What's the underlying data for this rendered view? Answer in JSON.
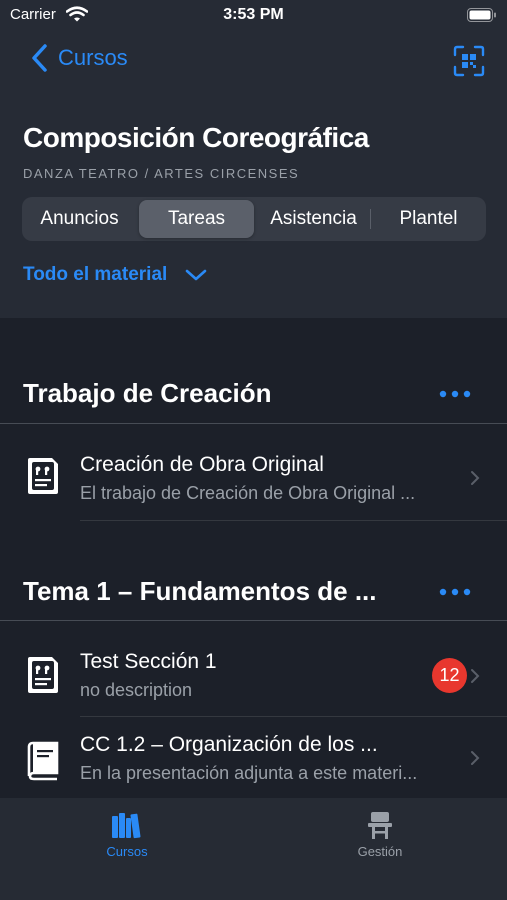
{
  "status_bar": {
    "carrier": "Carrier",
    "time": "3:53 PM"
  },
  "nav": {
    "back_label": "Cursos"
  },
  "course": {
    "title": "Composición Coreográfica",
    "subtitle": "DANZA TEATRO / ARTES CIRCENSES"
  },
  "segments": {
    "items": [
      "Anuncios",
      "Tareas",
      "Asistencia",
      "Plantel"
    ],
    "selected": "Tareas"
  },
  "filter": {
    "label": "Todo el material"
  },
  "sections": [
    {
      "title": "Trabajo de Creación",
      "items": [
        {
          "title": "Creación de Obra Original",
          "description": "El trabajo de Creación de Obra Original ...",
          "icon": "quote-document-icon",
          "badge": ""
        }
      ]
    },
    {
      "title": "Tema 1 – Fundamentos de ...",
      "items": [
        {
          "title": "Test Sección 1",
          "description": "no description",
          "icon": "quote-document-icon",
          "badge": "12"
        },
        {
          "title": "CC 1.2 – Organización de los ...",
          "description": "En la presentación adjunta a este materi...",
          "icon": "book-icon",
          "badge": ""
        }
      ]
    }
  ],
  "tabbar": {
    "items": [
      {
        "label": "Cursos",
        "icon": "books-icon",
        "active": true
      },
      {
        "label": "Gestión",
        "icon": "desk-chair-icon",
        "active": false
      }
    ]
  },
  "colors": {
    "accent": "#2a8af6",
    "badge": "#e8372e",
    "background": "#1c2029",
    "header": "#262b35",
    "secondary_text": "#9aa0a8",
    "inactive_tab": "#9aa0a8"
  }
}
